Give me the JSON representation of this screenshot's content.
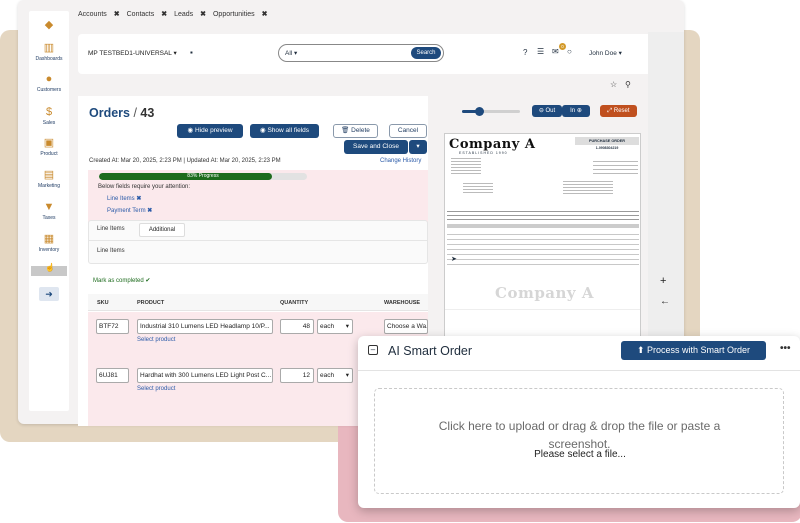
{
  "nav_tabs": [
    "Accounts",
    "Contacts",
    "Leads",
    "Opportunities"
  ],
  "sidebar": [
    {
      "label": "",
      "icon": "diamond-icon"
    },
    {
      "label": "Dashboards",
      "icon": "chart-icon"
    },
    {
      "label": "Customers",
      "icon": "people-icon"
    },
    {
      "label": "Sales",
      "icon": "dollar-icon"
    },
    {
      "label": "Product",
      "icon": "box-icon"
    },
    {
      "label": "Marketing",
      "icon": "book-icon"
    },
    {
      "label": "Taxes",
      "icon": "funnel-icon"
    },
    {
      "label": "Inventory",
      "icon": "clipboard-icon"
    }
  ],
  "topbar": {
    "company": "MP TESTBED1-UNIVERSAL",
    "search_scope": "All",
    "search_button": "Search",
    "user": "John Doe",
    "badge": "0"
  },
  "order": {
    "title": "Orders",
    "number": "43",
    "btn_hide_preview": "Hide preview",
    "btn_show_fields": "Show all fields",
    "btn_delete": "Delete",
    "btn_cancel": "Cancel",
    "btn_save_close": "Save and Close",
    "created": "Created At: Mar 20, 2025, 2:23 PM",
    "updated": "Updated At: Mar 20, 2025, 2:23 PM",
    "change_history": "Change History",
    "progress_label": "83% Progress",
    "progress": 0.83,
    "attention_title": "Below fields require your attention:",
    "attention_fields": [
      "Line Items",
      "Payment Term"
    ],
    "tabs": [
      "Line Items",
      "Additional"
    ],
    "section_label": "Line Items",
    "mark_completed": "Mark as completed",
    "columns": [
      "SKU",
      "PRODUCT",
      "QUANTITY",
      "WAREHOUSE"
    ],
    "rows": [
      {
        "sku": "BTF72",
        "product": "Industrial 310 Lumens LED Headlamp 10/P...",
        "qty": "48",
        "unit": "each",
        "warehouse": "Choose a Wa...",
        "select": "Select product"
      },
      {
        "sku": "6UJ81",
        "product": "Hardhat with 300 Lumens LED Light Post C...",
        "qty": "12",
        "unit": "each",
        "warehouse": "",
        "select": "Select product"
      }
    ]
  },
  "preview": {
    "out_label": "Out",
    "in_label": "In",
    "reset_label": "Reset",
    "zoom": 0.3
  },
  "document": {
    "company": "Company A",
    "tagline": "ESTABLISHED 1990",
    "doc_type": "PURCHASE ORDER",
    "doc_number": "1-0908304219",
    "watermark": "Company A"
  },
  "smart_order": {
    "title": "AI Smart Order",
    "process_button": "Process with Smart Order",
    "drop_text": "Click here to upload or drag & drop the file or paste a screenshot.",
    "select_text": "Please select a file..."
  },
  "colors": {
    "navy": "#1e4a7d",
    "green": "#1d6b1d",
    "orange": "#c0501f",
    "beige": "#e4d6c1",
    "pink": "#e8b7bf",
    "attention_bg": "#fbe9ec"
  }
}
